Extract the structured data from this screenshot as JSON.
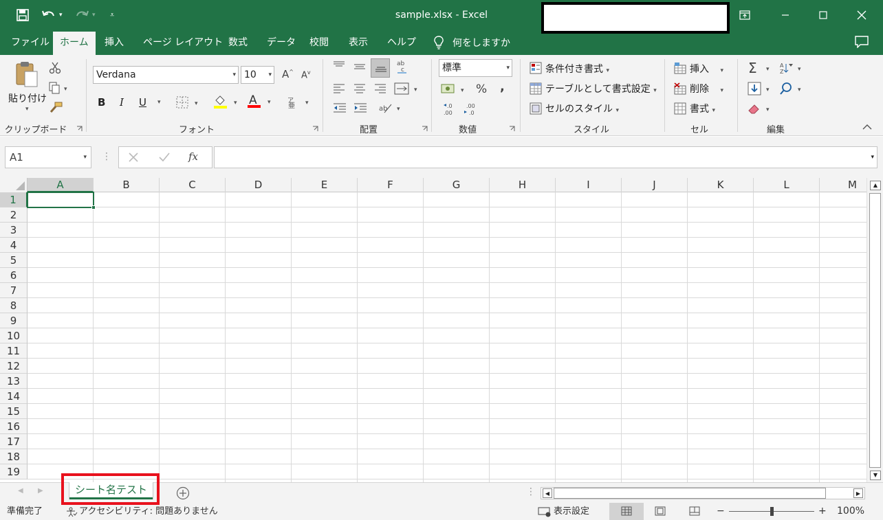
{
  "title_bar": {
    "filename": "sample.xlsx",
    "separator": " - ",
    "app": "Excel"
  },
  "menu": {
    "tabs": [
      "ファイル",
      "ホーム",
      "挿入",
      "ページ レイアウト",
      "数式",
      "データ",
      "校閲",
      "表示",
      "ヘルプ"
    ],
    "active_tab": "ホーム",
    "tell_me": "何をしますか"
  },
  "ribbon": {
    "clipboard": {
      "label": "クリップボード",
      "paste": "貼り付け"
    },
    "font": {
      "label": "フォント",
      "font_name": "Verdana",
      "font_size": "10",
      "bold": "B",
      "italic": "I",
      "underline": "U",
      "grow": "A",
      "shrink": "A",
      "font_color_letter": "A"
    },
    "alignment": {
      "label": "配置"
    },
    "number": {
      "label": "数値",
      "format": "標準",
      "percent": "%",
      "comma": ","
    },
    "styles": {
      "label": "スタイル",
      "conditional": "条件付き書式",
      "as_table": "テーブルとして書式設定",
      "cell_styles": "セルのスタイル"
    },
    "cells": {
      "label": "セル",
      "insert": "挿入",
      "delete": "削除",
      "format": "書式"
    },
    "editing": {
      "label": "編集"
    }
  },
  "formula_bar": {
    "name_box": "A1",
    "formula": "",
    "fx": "fx"
  },
  "grid": {
    "columns": [
      "A",
      "B",
      "C",
      "D",
      "E",
      "F",
      "G",
      "H",
      "I",
      "J",
      "K",
      "L",
      "M"
    ],
    "rows": [
      "1",
      "2",
      "3",
      "4",
      "5",
      "6",
      "7",
      "8",
      "9",
      "10",
      "11",
      "12",
      "13",
      "14",
      "15",
      "16",
      "17",
      "18",
      "19"
    ],
    "selected_column": "A",
    "selected_row": "1"
  },
  "sheets": {
    "tabs": [
      "シート名テスト"
    ],
    "active": "シート名テスト"
  },
  "status_bar": {
    "ready": "準備完了",
    "accessibility": "アクセシビリティ: 問題ありません",
    "display_settings": "表示設定",
    "zoom": "100%",
    "zoom_minus": "−",
    "zoom_plus": "+"
  },
  "colors": {
    "brand": "#217346",
    "highlight_red": "#e8111d",
    "fill_yellow": "#ffff00",
    "font_red": "#ff0000"
  }
}
